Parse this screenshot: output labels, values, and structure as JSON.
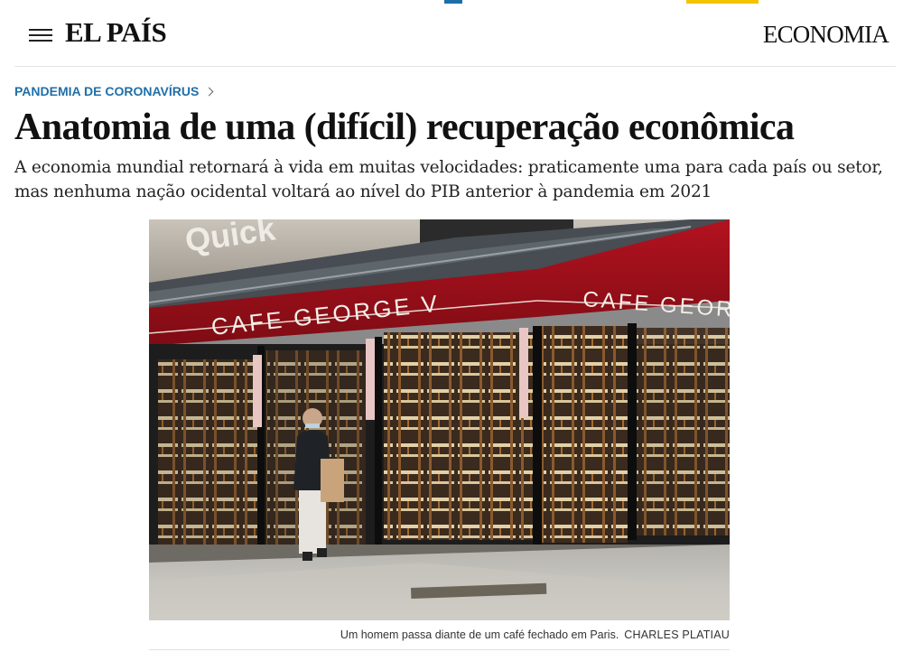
{
  "header": {
    "logo": "EL PAÍS",
    "section": "ECONOMIA",
    "menu_icon": "hamburger-menu-icon"
  },
  "article": {
    "kicker": "PANDEMIA DE CORONAVÍRUS",
    "headline": "Anatomia de uma (difícil) recuperação econômica",
    "subtitle": "A economia mundial retornará à vida em muitas velocidades: praticamente uma para cada país ou setor, mas nenhuma nação ocidental voltará ao nível do PIB anterior à pandemia em 2021",
    "image": {
      "sign_left": "CAFE GEORGE V",
      "sign_right": "CAFE GEORGE V",
      "sign_top": "Quick",
      "caption": "Um homem passa diante de um café fechado em Paris.",
      "credit": "CHARLES PLATIAU"
    }
  },
  "colors": {
    "kicker": "#1f6fa9",
    "awning": "#a3121d",
    "accent_yellow": "#f4c300",
    "accent_blue": "#1e6ea7"
  }
}
